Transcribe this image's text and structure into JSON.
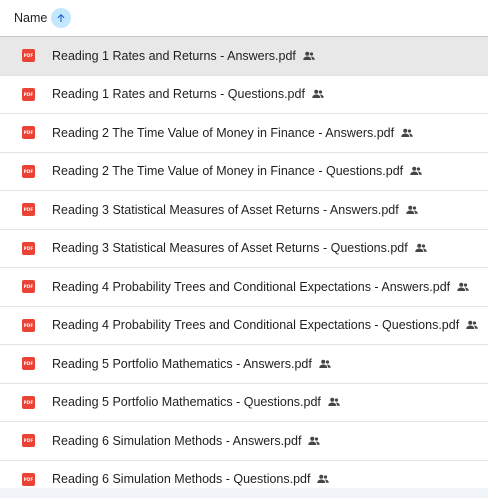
{
  "header": {
    "name_label": "Name",
    "sort_icon": "arrow-upward-icon"
  },
  "files": [
    {
      "name": "Reading 1 Rates and Returns - Answers.pdf",
      "selected": true
    },
    {
      "name": "Reading 1 Rates and Returns - Questions.pdf"
    },
    {
      "name": "Reading 2 The Time Value of Money in Finance - Answers.pdf"
    },
    {
      "name": "Reading 2 The Time Value of Money in Finance - Questions.pdf"
    },
    {
      "name": "Reading 3 Statistical Measures of Asset Returns - Answers.pdf"
    },
    {
      "name": "Reading 3 Statistical Measures of Asset Returns - Questions.pdf"
    },
    {
      "name": "Reading 4 Probability Trees and Conditional Expectations - Answers.pdf"
    },
    {
      "name": "Reading 4 Probability Trees and Conditional Expectations - Questions.pdf"
    },
    {
      "name": "Reading 5 Portfolio Mathematics - Answers.pdf"
    },
    {
      "name": "Reading 5 Portfolio Mathematics - Questions.pdf"
    },
    {
      "name": "Reading 6 Simulation Methods - Answers.pdf"
    },
    {
      "name": "Reading 6 Simulation Methods - Questions.pdf"
    }
  ],
  "icons": {
    "file_type": "pdf-icon",
    "file_type_text": "PDF",
    "shared": "shared-people-icon"
  },
  "colors": {
    "pdf_red": "#ea4335",
    "sort_bg": "#c2e7ff",
    "sort_arrow": "#0b57d0",
    "selected_row": "#e8e8e8"
  }
}
